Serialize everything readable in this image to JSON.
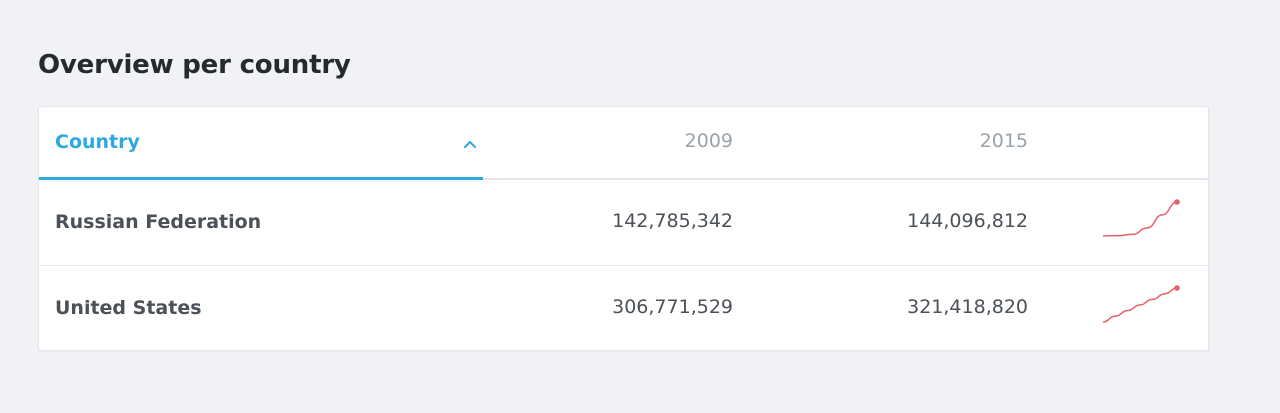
{
  "page": {
    "title": "Overview per country"
  },
  "table": {
    "columns": {
      "country": "Country",
      "year_1": "2009",
      "year_2": "2015"
    },
    "sort": "ascending",
    "rows": [
      {
        "country": "Russian Federation",
        "value_2009": "142,785,342",
        "value_2015": "144,096,812",
        "trend_values": [
          142785342,
          142800000,
          142850000,
          143100000,
          143600000,
          144096812
        ]
      },
      {
        "country": "United States",
        "value_2009": "306,771,529",
        "value_2015": "321,418,820",
        "trend_values": [
          306771529,
          309300000,
          311700000,
          314100000,
          316500000,
          318900000,
          321418820
        ]
      }
    ]
  },
  "colors": {
    "accent": "#2ea8e0",
    "sparkline": "#e8606a",
    "background": "#f1f2f5"
  },
  "icons": {
    "sort": "chevron-up-icon"
  }
}
